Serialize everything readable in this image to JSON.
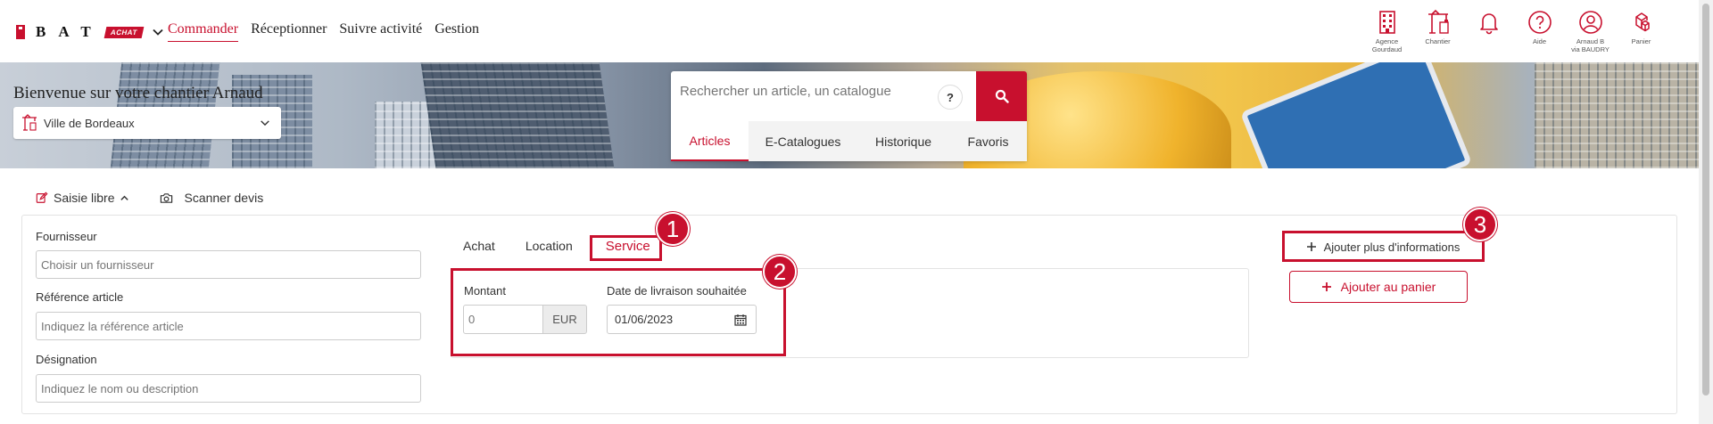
{
  "brand": {
    "letters": "BAT",
    "badge": "ACHAT",
    "red": "#c8102e"
  },
  "nav": [
    {
      "label": "Commander",
      "active": true
    },
    {
      "label": "Réceptionner"
    },
    {
      "label": "Suivre activité"
    },
    {
      "label": "Gestion"
    }
  ],
  "top_actions": [
    {
      "icon": "agency-building-icon",
      "label": "Agence Gourdaud"
    },
    {
      "icon": "crane-icon",
      "label": "Chantier"
    },
    {
      "icon": "bell-icon",
      "label": ""
    },
    {
      "icon": "help-icon",
      "label": "Aide"
    },
    {
      "icon": "user-icon",
      "label": "Arnaud B",
      "sublabel": "via BAUDRY"
    },
    {
      "icon": "cart-icon",
      "label": "Panier"
    }
  ],
  "banner": {
    "welcome": "Bienvenue sur votre chantier Arnaud",
    "site": "Ville de Bordeaux"
  },
  "search": {
    "placeholder": "Rechercher un article, un catalogue",
    "help": "?",
    "tabs": [
      {
        "label": "Articles",
        "active": true
      },
      {
        "label": "E-Catalogues"
      },
      {
        "label": "Historique"
      },
      {
        "label": "Favoris"
      }
    ]
  },
  "modes": {
    "free_entry": "Saisie libre",
    "scan": "Scanner devis"
  },
  "form": {
    "supplier_label": "Fournisseur",
    "supplier_placeholder": "Choisir un fournisseur",
    "reference_label": "Référence article",
    "reference_placeholder": "Indiquez la référence article",
    "designation_label": "Désignation",
    "designation_placeholder": "Indiquez le nom ou description"
  },
  "type_tabs": [
    {
      "label": "Achat"
    },
    {
      "label": "Location"
    },
    {
      "label": "Service",
      "active": true
    }
  ],
  "service": {
    "amount_label": "Montant",
    "amount_placeholder": "0",
    "currency": "EUR",
    "date_label": "Date de livraison souhaitée",
    "date_value": "01/06/2023"
  },
  "actions": {
    "more_info": "Ajouter plus d'informations",
    "add_to_cart": "Ajouter au panier"
  },
  "annotations": [
    "1",
    "2",
    "3"
  ]
}
